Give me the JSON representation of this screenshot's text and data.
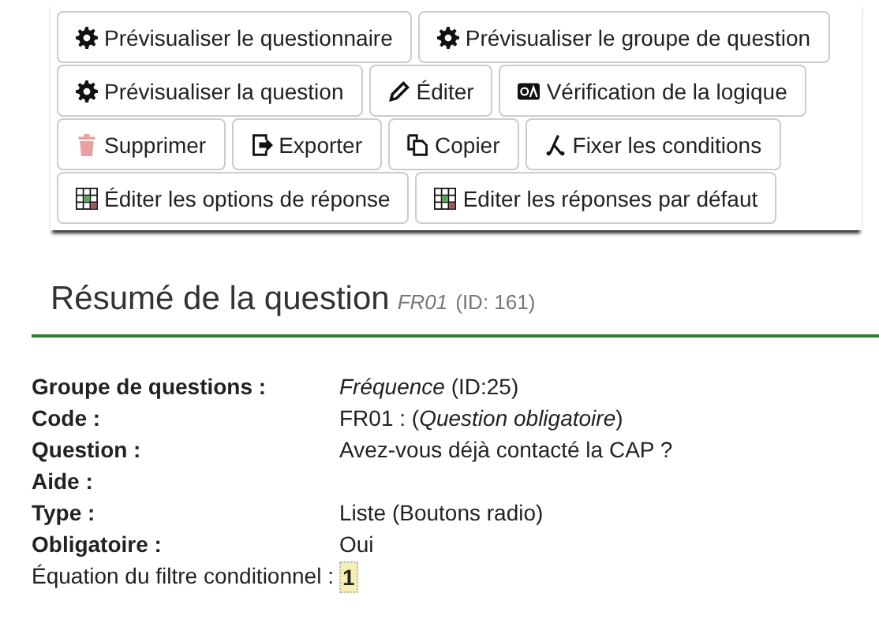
{
  "toolbar": {
    "buttons": [
      {
        "label": "Prévisualiser le questionnaire",
        "kind": "preview"
      },
      {
        "label": "Prévisualiser le groupe de question",
        "kind": "preview"
      },
      {
        "label": "Prévisualiser la question",
        "kind": "preview"
      },
      {
        "label": "Éditer",
        "kind": "edit"
      },
      {
        "label": "Vérification de la logique",
        "kind": "logic"
      },
      {
        "label": "Supprimer",
        "kind": "delete"
      },
      {
        "label": "Exporter",
        "kind": "export"
      },
      {
        "label": "Copier",
        "kind": "copy"
      },
      {
        "label": "Fixer les conditions",
        "kind": "conditions"
      },
      {
        "label": "Éditer les options de réponse",
        "kind": "grid"
      },
      {
        "label": "Editer les réponses par défaut",
        "kind": "grid"
      }
    ]
  },
  "summary": {
    "title": "Résumé de la question",
    "code": "FR01",
    "id": "(ID: 161)",
    "rows": [
      {
        "kind": "field",
        "label": "Groupe de questions :",
        "value": "*Fréquence* (ID:25)"
      },
      {
        "kind": "field",
        "label": "Code :",
        "value": "FR01 : (*Question obligatoire*)"
      },
      {
        "kind": "field",
        "label": "Question :",
        "value": "Avez-vous déjà contacté la CAP ?"
      },
      {
        "kind": "field",
        "label": "Aide :"
      },
      {
        "kind": "field",
        "label": "Type :",
        "value": "Liste (Boutons radio)"
      },
      {
        "kind": "field",
        "label": "Obligatoire :",
        "value": "Oui"
      },
      {
        "kind": "equation",
        "label": "Équation du filtre conditionnel :",
        "value": "1"
      }
    ]
  }
}
